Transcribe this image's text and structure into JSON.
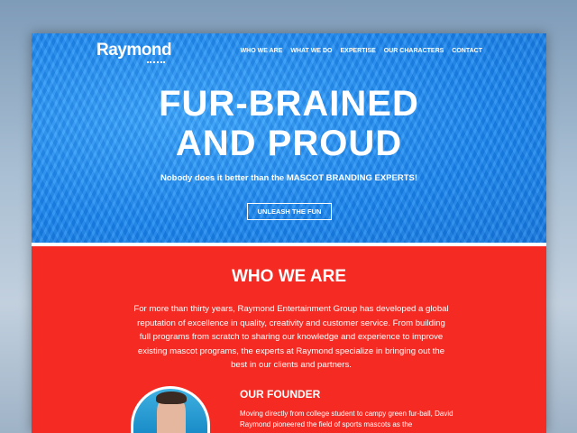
{
  "header": {
    "logo": "Raymond",
    "nav": [
      "WHO WE ARE",
      "WHAT WE DO",
      "EXPERTISE",
      "OUR CHARACTERS",
      "CONTACT"
    ]
  },
  "hero": {
    "title_line1": "FUR-BRAINED",
    "title_line2": "AND PROUD",
    "subtitle": "Nobody does it better than the MASCOT BRANDING EXPERTS!",
    "cta": "UNLEASH THE FUN"
  },
  "who": {
    "heading": "WHO WE ARE",
    "text": "For more than thirty years, Raymond Entertainment Group has developed a global reputation of excellence in quality, creativity and customer service. From building full programs from scratch to sharing our knowledge and experience to improve existing mascot programs, the experts at Raymond specialize in bringing out the best in our clients and partners."
  },
  "founder": {
    "heading": "OUR FOUNDER",
    "text": "Moving directly from college student to campy green fur-ball, David Raymond pioneered the field of sports mascots as the"
  }
}
